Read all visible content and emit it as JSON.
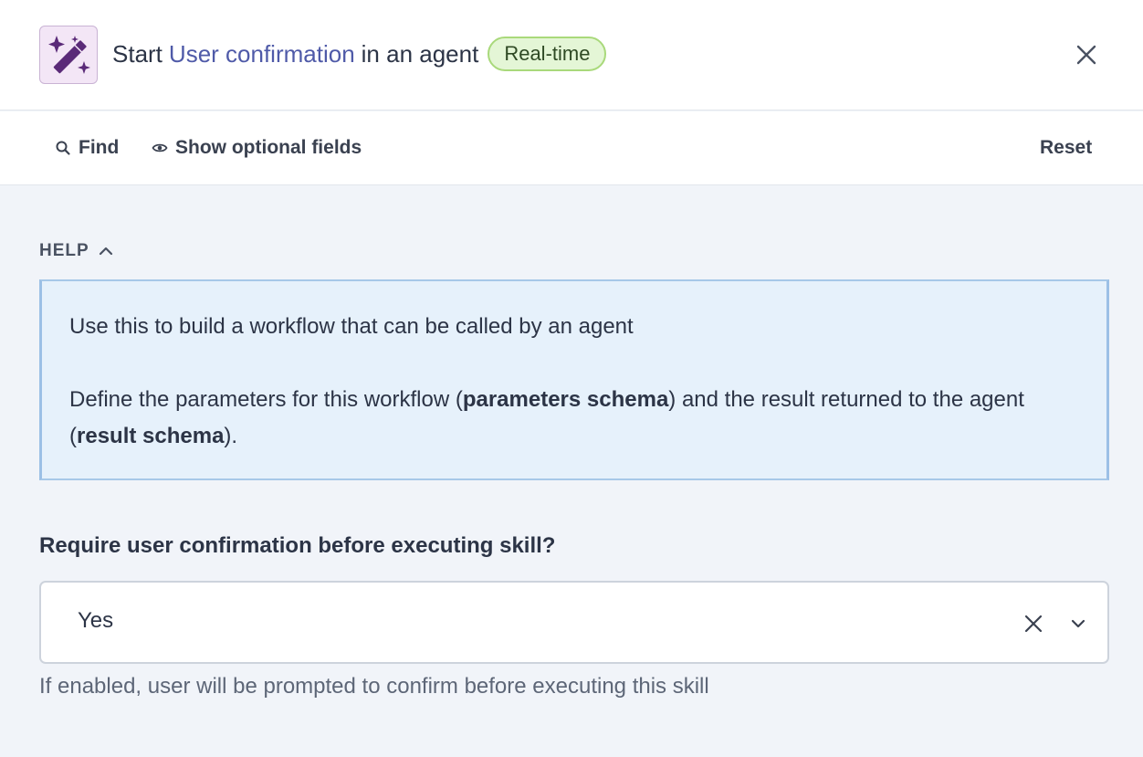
{
  "header": {
    "icon": "magic-wand-icon",
    "title_prefix": "Start",
    "title_link": "User confirmation",
    "title_suffix": "in an agent",
    "badge": "Real-time",
    "close_icon": "close-icon"
  },
  "toolbar": {
    "find_label": "Find",
    "show_optional_label": "Show optional fields",
    "reset_label": "Reset"
  },
  "help": {
    "title": "HELP",
    "line1": "Use this to build a workflow that can be called by an agent",
    "line2_a": "Define the parameters for this workflow (",
    "line2_b": "parameters schema",
    "line2_c": ") and the result returned to the agent (",
    "line2_d": "result schema",
    "line2_e": ")."
  },
  "field": {
    "label": "Require user confirmation before executing skill?",
    "value": "Yes",
    "hint": "If enabled, user will be prompted to confirm before executing this skill"
  },
  "colors": {
    "accent": "#4f5aa8",
    "badge_bg": "#e4f6d6",
    "badge_border": "#a9d97b",
    "icon_bg": "#f3e6f6",
    "icon_fg": "#5a2a78",
    "help_bg": "#e6f1fb",
    "help_border": "#a7c8e8"
  }
}
